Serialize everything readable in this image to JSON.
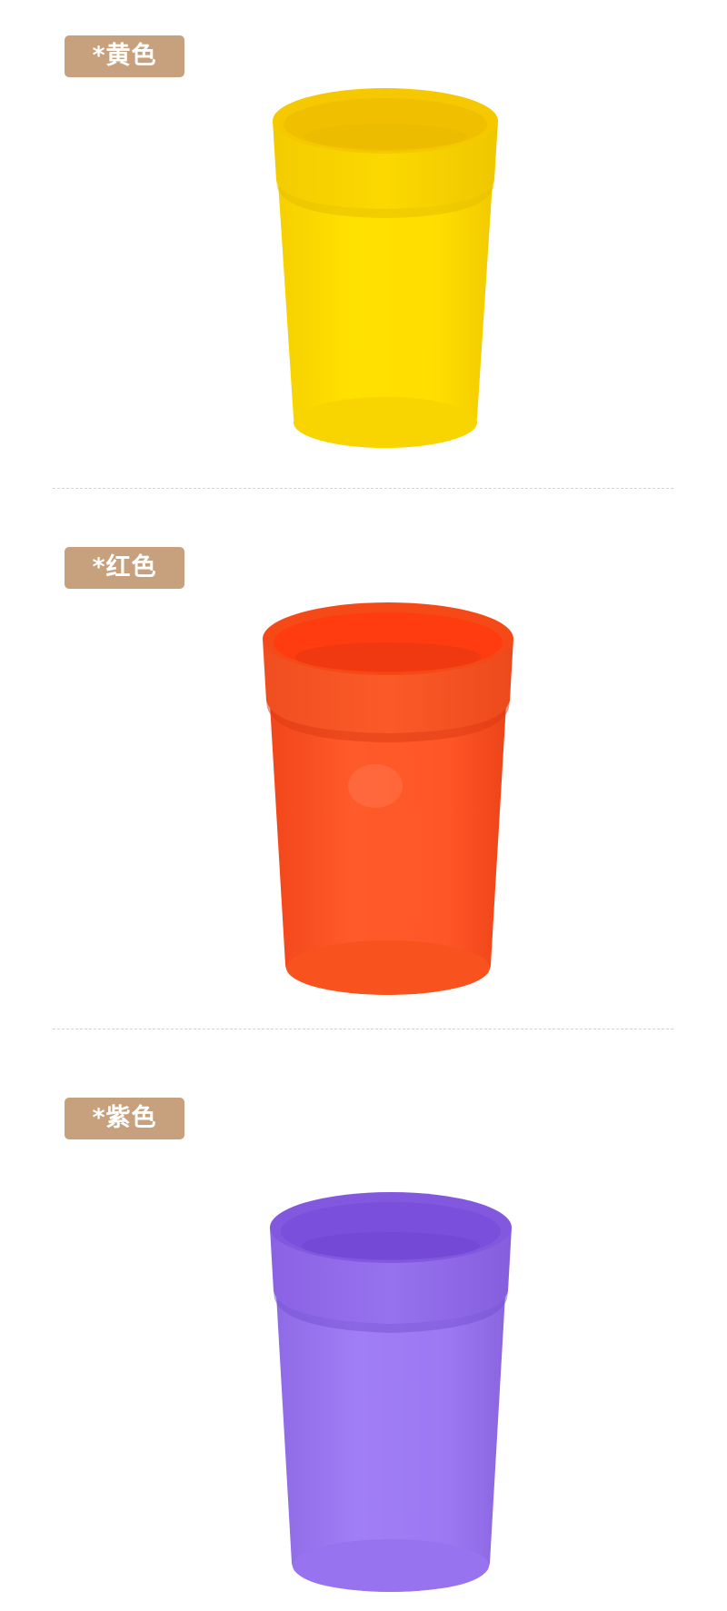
{
  "products": [
    {
      "label": "*黄色",
      "color_name": "yellow",
      "color": "#ffdc00"
    },
    {
      "label": "*红色",
      "color_name": "red",
      "color": "#ff5424"
    },
    {
      "label": "*紫色",
      "color_name": "purple",
      "color": "#9a74ee"
    }
  ]
}
